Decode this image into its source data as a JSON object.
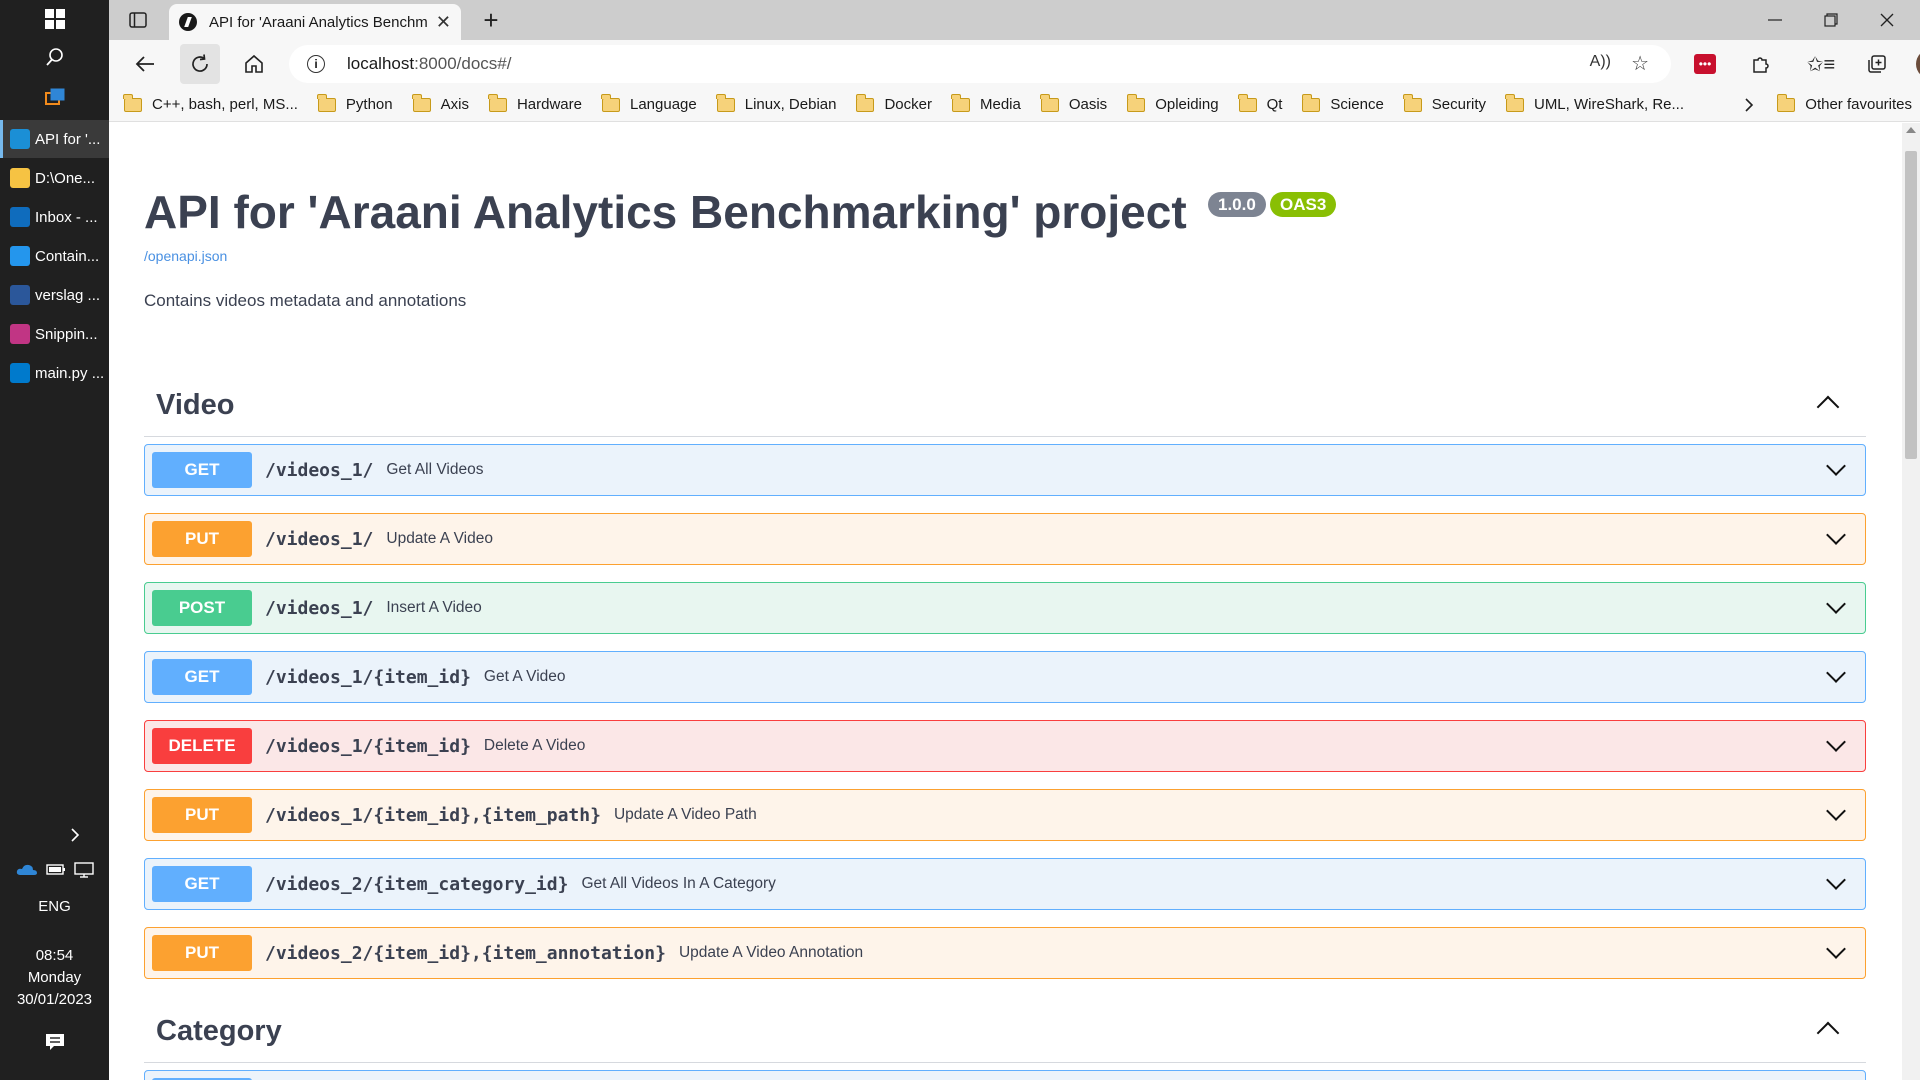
{
  "taskbar": {
    "apps": [
      {
        "label": "API for '...",
        "icon": "edge-icon",
        "color": "#1b8fd6",
        "active": true
      },
      {
        "label": "D:\\One...",
        "icon": "folder-icon",
        "color": "#f6c343",
        "active": false
      },
      {
        "label": "Inbox - ...",
        "icon": "outlook-icon",
        "color": "#0f6cbd",
        "active": false
      },
      {
        "label": "Contain...",
        "icon": "docker-icon",
        "color": "#2496ed",
        "active": false
      },
      {
        "label": "verslag ...",
        "icon": "word-icon",
        "color": "#2b579a",
        "active": false
      },
      {
        "label": "Snippin...",
        "icon": "snipping-icon",
        "color": "#c13584",
        "active": false
      },
      {
        "label": "main.py ...",
        "icon": "vscode-icon",
        "color": "#007acc",
        "active": false
      }
    ],
    "language": "ENG",
    "time": "08:54",
    "day": "Monday",
    "date": "30/01/2023"
  },
  "browser": {
    "tab_title": "API for 'Araani Analytics Benchm",
    "url_host": "localhost",
    "url_path": ":8000/docs#/",
    "bookmarks": [
      "C++, bash, perl, MS...",
      "Python",
      "Axis",
      "Hardware",
      "Language",
      "Linux, Debian",
      "Docker",
      "Media",
      "Oasis",
      "Opleiding",
      "Qt",
      "Science",
      "Security",
      "UML, WireShark, Re..."
    ],
    "other_favourites": "Other favourites"
  },
  "api": {
    "title": "API for 'Araani Analytics Benchmarking' project",
    "version": "1.0.0",
    "oas": "OAS3",
    "openapi_link": "/openapi.json",
    "description": "Contains videos metadata and annotations"
  },
  "sections": [
    {
      "title": "Video",
      "operations": [
        {
          "method": "GET",
          "path": "/videos_1/",
          "summary": "Get All Videos"
        },
        {
          "method": "PUT",
          "path": "/videos_1/",
          "summary": "Update A Video"
        },
        {
          "method": "POST",
          "path": "/videos_1/",
          "summary": "Insert A Video"
        },
        {
          "method": "GET",
          "path": "/videos_1/{item_id}",
          "summary": "Get A Video"
        },
        {
          "method": "DELETE",
          "path": "/videos_1/{item_id}",
          "summary": "Delete A Video"
        },
        {
          "method": "PUT",
          "path": "/videos_1/{item_id},{item_path}",
          "summary": "Update A Video Path"
        },
        {
          "method": "GET",
          "path": "/videos_2/{item_category_id}",
          "summary": "Get All Videos In A Category"
        },
        {
          "method": "PUT",
          "path": "/videos_2/{item_id},{item_annotation}",
          "summary": "Update A Video Annotation"
        }
      ]
    },
    {
      "title": "Category",
      "operations": []
    }
  ],
  "colors": {
    "get": "#61affe",
    "put": "#fca130",
    "post": "#49cc90",
    "delete": "#f93e3e",
    "version_badge": "#7d8492",
    "oas_badge": "#89bf04"
  }
}
